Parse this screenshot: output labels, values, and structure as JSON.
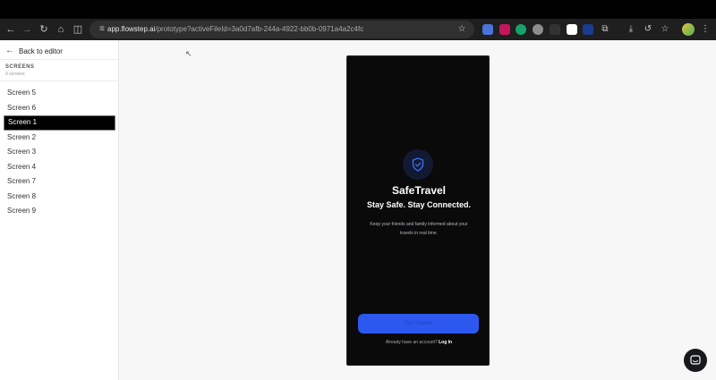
{
  "browser": {
    "url_host": "app.flowstep.ai",
    "url_path": "/prototype?activeFileId=3a0d7afb-244a-4922-bb0b-0971a4a2c4fc"
  },
  "sidebar": {
    "back_label": "Back to editor",
    "section_title": "SCREENS",
    "section_count": "9 screens",
    "screens": [
      "Screen 5",
      "Screen 6",
      "Screen 1",
      "Screen 2",
      "Screen 3",
      "Screen 4",
      "Screen 7",
      "Screen 8",
      "Screen 9"
    ],
    "active_index": 2
  },
  "phone": {
    "app_name": "SafeTravel",
    "tagline": "Stay Safe. Stay Connected.",
    "description": "Keep your friends and family informed about your travels in real time.",
    "cta_label": "Get Started",
    "login_prompt": "Already have an account? ",
    "login_link": "Log In"
  },
  "colors": {
    "accent": "#2c58f0",
    "phone_bg": "#0a0a0b"
  }
}
